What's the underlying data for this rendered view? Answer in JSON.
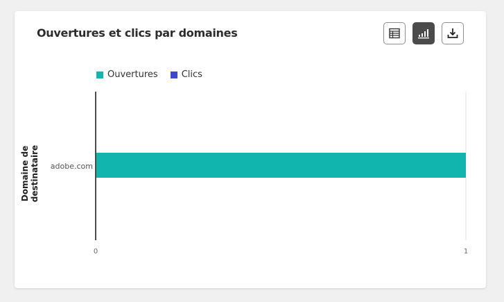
{
  "card": {
    "title": "Ouvertures et clics par domaines"
  },
  "toolbar": [
    {
      "icon": "table-icon",
      "label": "Tableau",
      "active": false
    },
    {
      "icon": "bar-chart-icon",
      "label": "Graphique",
      "active": true
    },
    {
      "icon": "download-icon",
      "label": "Télécharger",
      "active": false
    }
  ],
  "chart_data": {
    "type": "bar",
    "orientation": "horizontal",
    "categories": [
      "adobe.com"
    ],
    "series": [
      {
        "name": "Ouvertures",
        "values": [
          1
        ],
        "color": "#12b5ae"
      },
      {
        "name": "Clics",
        "values": [
          0
        ],
        "color": "#3f48cc"
      }
    ],
    "xlim": [
      0,
      1
    ],
    "xticks": [
      "0",
      "1"
    ],
    "ylabel": "Domaine de destinataire",
    "legend": "top-left",
    "grid": false
  }
}
